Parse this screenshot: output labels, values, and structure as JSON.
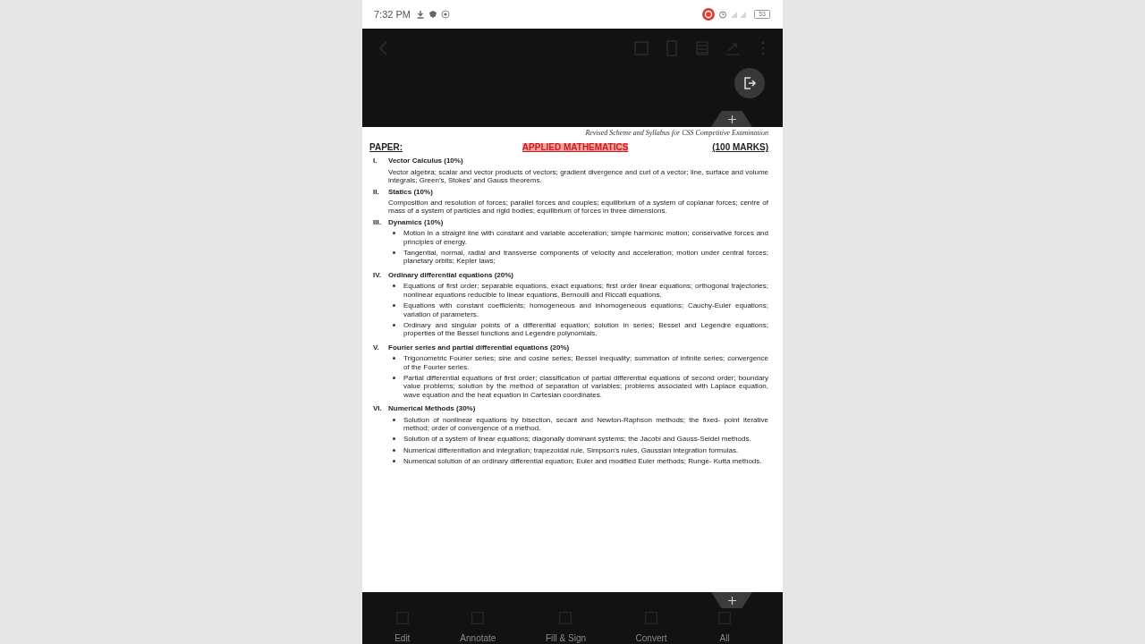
{
  "status_bar": {
    "time": "7:32 PM",
    "battery": "53"
  },
  "document": {
    "header_note": "Revised Scheme and Syllabus for CSS Competitive Examination",
    "paper_label": "PAPER:",
    "paper_title": "APPLIED MATHEMATICS",
    "marks": "(100 MARKS)",
    "sections": [
      {
        "numeral": "I.",
        "heading": "Vector Calculus (10%)",
        "text": "Vector algebra; scalar and vector products of vectors; gradient divergence and curl of a vector; line, surface and volume integrals; Green’s, Stokes’ and Gauss theorems."
      },
      {
        "numeral": "II.",
        "heading": "Statics (10%)",
        "text": "Composition and resolution of forces; parallel forces and couples; equilibrium of a system of coplanar forces; centre of mass of a system of particles and rigid bodies; equilibrium of forces in three dimensions."
      },
      {
        "numeral": "III.",
        "heading": "Dynamics (10%)",
        "bullets": [
          "Motion in a straight line with constant and variable acceleration; simple harmonic motion; conservative forces and principles of energy.",
          "Tangential, normal, radial and transverse components of velocity and acceleration; motion under central forces; planetary orbits; Kepler laws;"
        ]
      },
      {
        "numeral": "IV.",
        "heading": "Ordinary differential equations (20%)",
        "bullets": [
          "Equations of first order; separable equations, exact equations; first order linear equations; orthogonal trajectories; nonlinear equations reducible to linear equations, Bernoulli and Riccati equations.",
          "Equations with constant coefficients; homogeneous and inhomogeneous equations; Cauchy-Euler equations; variation of parameters.",
          "Ordinary and singular points of a differential equation; solution in series; Bessel and Legendre equations; properties of the Bessel functions and Legendre polynomials."
        ]
      },
      {
        "numeral": "V.",
        "heading": "Fourier series and partial differential equations (20%)",
        "bullets": [
          "Trigonometric Fourier series; sine and cosine series; Bessel inequality; summation of infinite series; convergence of the Fourier series.",
          "Partial differential equations of first order; classification of partial differential equations of second order; boundary value problems; solution by the method of separation of variables; problems associated with Laplace equation, wave equation and the heat equation in Cartesian coordinates."
        ]
      },
      {
        "numeral": "VI.",
        "heading": "Numerical Methods (30%)",
        "bullets": [
          "Solution of nonlinear equations by bisection, secant and Newton-Raphson methods; the fixed- point iterative method; order of convergence of a method.",
          "Solution of a system of linear equations; diagonally dominant systems; the Jacobi and Gauss-Seidel methods.",
          "Numerical differentiation and integration; trapezoidal rule, Simpson’s rules, Gaussian integration formulas.",
          "Numerical solution of an ordinary differential equation; Euler and modified Euler methods; Runge- Kutta methods."
        ]
      }
    ]
  },
  "bottom_bar": {
    "tabs": [
      "Edit",
      "Annotate",
      "Fill & Sign",
      "Convert",
      "All"
    ]
  }
}
